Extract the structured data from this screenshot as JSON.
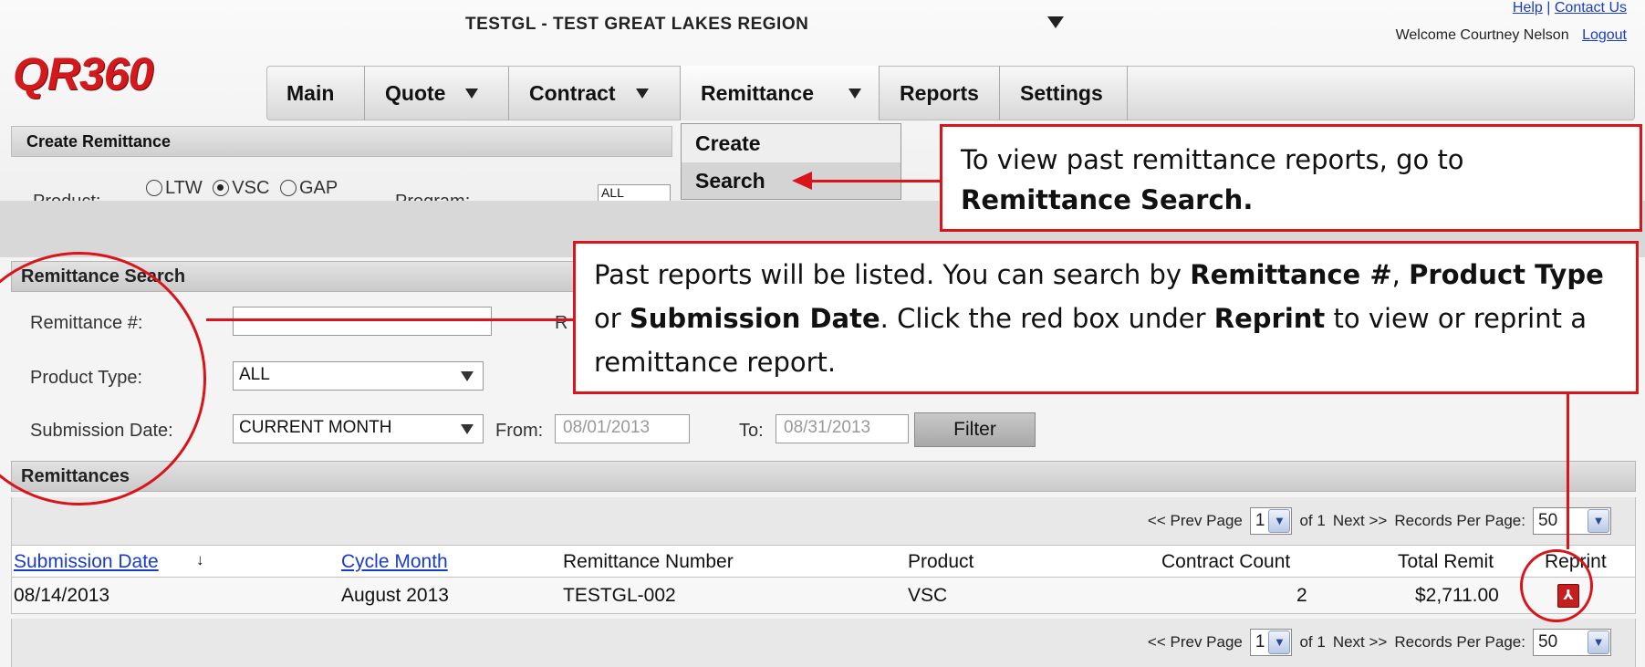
{
  "top": {
    "region": "TESTGL - TEST GREAT LAKES REGION",
    "help": "Help",
    "contact": "Contact Us",
    "welcome": "Welcome Courtney Nelson",
    "logout": "Logout",
    "logo": "QR360",
    "nav": {
      "main": "Main",
      "quote": "Quote",
      "contract": "Contract",
      "remittance": "Remittance",
      "reports": "Reports",
      "settings": "Settings"
    },
    "dropdown": {
      "create": "Create",
      "search": "Search"
    },
    "create_header": "Create Remittance",
    "product_label": "Product:",
    "product_options": [
      "LTW",
      "VSC",
      "GAP"
    ],
    "program_label": "Program:",
    "program_value": "ALL"
  },
  "search": {
    "header": "Remittance Search",
    "remittance_label": "Remittance #:",
    "remittance_value": "",
    "hidden_label": "R",
    "product_type_label": "Product Type:",
    "product_type_value": "ALL",
    "submission_label": "Submission Date:",
    "submission_value": "CURRENT MONTH",
    "from_label": "From:",
    "from_value": "08/01/2013",
    "to_label": "To:",
    "to_value": "08/31/2013",
    "filter": "Filter"
  },
  "remittances": {
    "header": "Remittances",
    "pager": {
      "prev": "<< Prev Page",
      "page": "1",
      "of": "of 1",
      "next": "Next >>",
      "records_label": "Records Per Page:",
      "records_value": "50"
    },
    "columns": {
      "submission_date": "Submission Date",
      "sort_arrow": "↓",
      "cycle_month": "Cycle Month",
      "remittance_number": "Remittance Number",
      "product": "Product",
      "contract_count": "Contract Count",
      "total_remit": "Total Remit",
      "reprint": "Reprint"
    },
    "rows": [
      {
        "submission_date": "08/14/2013",
        "cycle_month": "August 2013",
        "remittance_number": "TESTGL-002",
        "product": "VSC",
        "contract_count": "2",
        "total_remit": "$2,711.00"
      }
    ]
  },
  "callouts": {
    "first": {
      "text": "To view past remittance reports, go to",
      "bold": "Remittance Search."
    },
    "second": {
      "t1": "Past reports will be listed. You can search by ",
      "b1": "Remittance #",
      "t2": ", ",
      "b2": "Product Type",
      "t3": " or ",
      "b3": "Submission Date",
      "t4": ". Click the red box under ",
      "b4": "Reprint",
      "t5": " to view or reprint a remittance report."
    }
  },
  "colors": {
    "accent": "#d9141a",
    "link": "#1a3cc8",
    "logo": "#d3191c"
  }
}
